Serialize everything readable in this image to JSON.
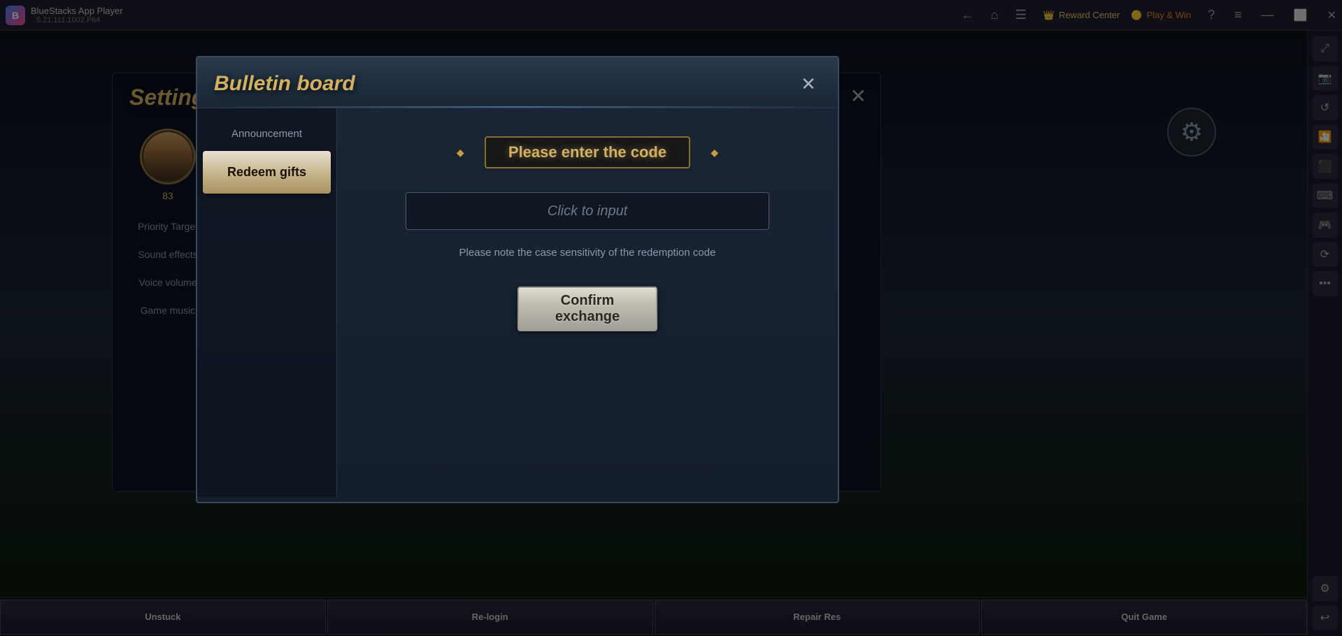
{
  "app": {
    "name": "BlueStacks App Player",
    "version": "5.21.111.1002  P64"
  },
  "titlebar": {
    "back_label": "←",
    "home_label": "⌂",
    "bookmark_label": "☰",
    "reward_label": "Reward Center",
    "playnwin_label": "Play & Win",
    "help_label": "?",
    "menu_label": "≡",
    "minimize_label": "—",
    "restore_label": "⬜",
    "close_label": "✕"
  },
  "settings": {
    "title": "Settings",
    "close_label": "✕",
    "avatar_level": "83",
    "menu_items": [
      {
        "label": "Priority Target"
      },
      {
        "label": "Sound effects"
      },
      {
        "label": "Voice volume"
      },
      {
        "label": "Game music"
      }
    ]
  },
  "bulletin": {
    "title": "Bulletin board",
    "close_label": "✕",
    "tabs": [
      {
        "label": "Announcement",
        "active": false
      },
      {
        "label": "Redeem gifts",
        "active": true
      }
    ],
    "redeem": {
      "code_title": "Please enter the code",
      "input_placeholder": "Click to input",
      "note": "Please note the case sensitivity of the redemption code",
      "confirm_label": "Confirm\nexchange"
    }
  },
  "bottom_bar": {
    "buttons": [
      {
        "label": "Unstuck"
      },
      {
        "label": "Re-login"
      },
      {
        "label": "Repair Res"
      },
      {
        "label": "Quit Game"
      }
    ]
  },
  "sidebar_icons": [
    "resize-icon",
    "screenshot-icon",
    "refresh-icon",
    "camera-icon",
    "record-icon",
    "keyboard-icon",
    "settings-icon",
    "gamepad-icon",
    "sync-icon",
    "more-icon"
  ]
}
